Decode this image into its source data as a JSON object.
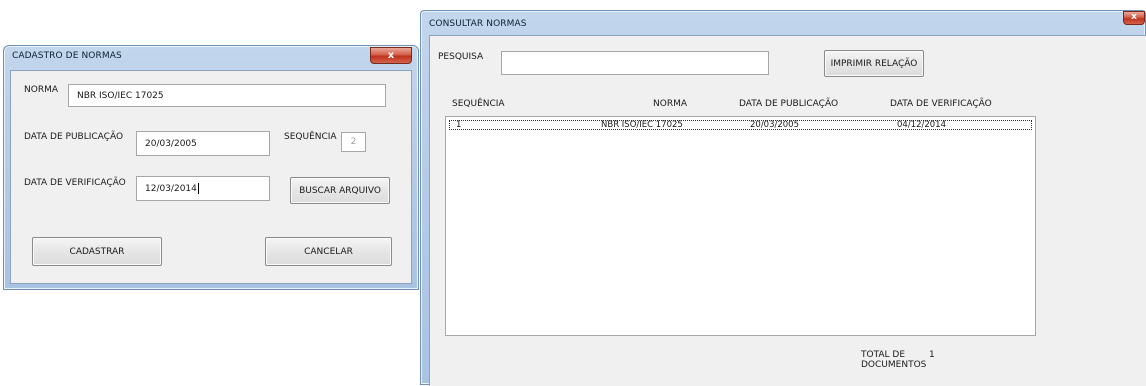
{
  "cadastro": {
    "title": "CADASTRO DE NORMAS",
    "close_glyph": "x",
    "norma_label": "NORMA",
    "norma_value": "NBR ISO/IEC 17025",
    "data_publicacao_label": "DATA DE PUBLICAÇÃO",
    "data_publicacao_value": "20/03/2005",
    "sequencia_label": "SEQUÊNCIA",
    "sequencia_value": "2",
    "data_verificacao_label": "DATA DE VERIFICAÇÃO",
    "data_verificacao_value": "12/03/2014",
    "buscar_label": "BUSCAR ARQUIVO",
    "cadastrar_label": "CADASTRAR",
    "cancelar_label": "CANCELAR"
  },
  "consultar": {
    "title": "CONSULTAR NORMAS",
    "close_glyph": "x",
    "pesquisa_label": "PESQUISA",
    "pesquisa_value": "",
    "imprimir_label": "IMPRIMIR RELAÇÃO",
    "columns": [
      "SEQUÊNCIA",
      "NORMA",
      "DATA DE PUBLICAÇÃO",
      "DATA DE VERIFICAÇÃO"
    ],
    "rows": [
      {
        "sequencia": "1",
        "norma": "NBR ISO/IEC 17025",
        "publicacao": "20/03/2005",
        "verificacao": "04/12/2014"
      }
    ],
    "total_label_1": "TOTAL DE",
    "total_label_2": "DOCUMENTOS",
    "total_value": "1"
  }
}
